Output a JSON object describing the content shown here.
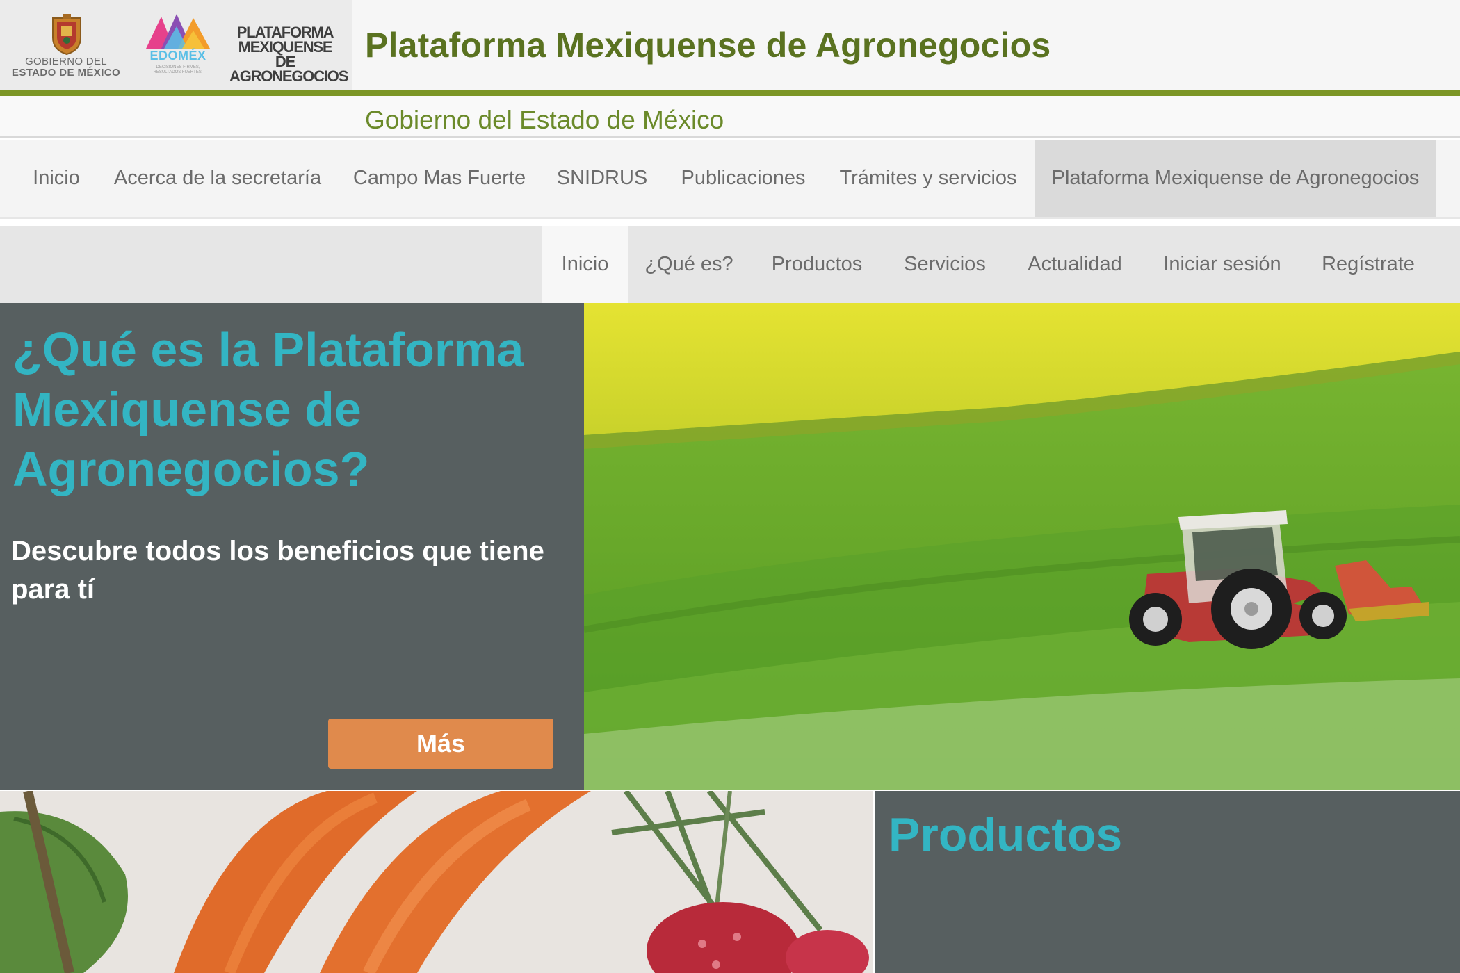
{
  "header": {
    "logo_gob_line1": "GOBIERNO DEL",
    "logo_gob_line2": "ESTADO DE MÉXICO",
    "logo_edomex": "EDOMÉX",
    "logo_edomex_tag": "DECISIONES FIRMES, RESULTADOS FUERTES.",
    "logo_platform": "PLATAFORMA MEXIQUENSE DE AGRONEGOCIOS",
    "title": "Plataforma Mexiquense de Agronegocios",
    "subtitle": "Gobierno del Estado de México"
  },
  "main_nav": [
    {
      "label": "Inicio"
    },
    {
      "label": "Acerca de la secretaría"
    },
    {
      "label": "Campo Mas Fuerte"
    },
    {
      "label": "SNIDRUS"
    },
    {
      "label": "Publicaciones"
    },
    {
      "label": "Trámites y servicios"
    },
    {
      "label": "Plataforma Mexiquense de Agronegocios",
      "active": true
    }
  ],
  "sub_nav": [
    {
      "label": "Inicio",
      "active": true
    },
    {
      "label": "¿Qué es?"
    },
    {
      "label": "Productos"
    },
    {
      "label": "Servicios"
    },
    {
      "label": "Actualidad"
    },
    {
      "label": "Iniciar sesión"
    },
    {
      "label": "Regístrate"
    }
  ],
  "hero": {
    "title": "¿Qué es la Plataforma Mexiquense de Agronegocios?",
    "text": "Descubre todos los beneficios que tiene para tí",
    "button_label": "Más"
  },
  "products": {
    "title": "Productos"
  },
  "colors": {
    "brand_green": "#5a7220",
    "rule_green": "#7c9626",
    "accent_teal": "#33b5c3",
    "panel_gray": "#575f60",
    "button_orange": "#e08a4c"
  }
}
